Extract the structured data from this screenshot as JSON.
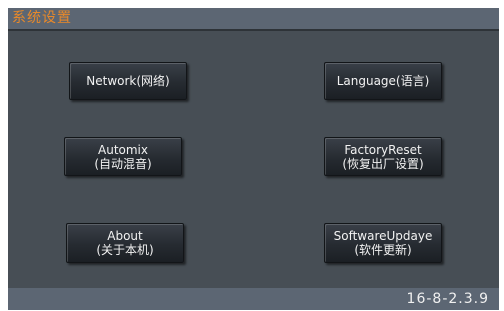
{
  "window": {
    "title": "系统设置"
  },
  "buttons": {
    "network": {
      "line1": "Network(网络)"
    },
    "language": {
      "line1": "Language(语言)"
    },
    "automix": {
      "line1": "Automix",
      "line2": "(自动混音)"
    },
    "factory_reset": {
      "line1": "FactoryReset",
      "line2": "(恢复出厂设置)"
    },
    "about": {
      "line1": "About",
      "line2": "(关于本机)"
    },
    "software_update": {
      "line1": "SoftwareUpdaye",
      "line2": "(软件更新)"
    }
  },
  "status": {
    "version": "16-8-2.3.9"
  },
  "colors": {
    "title_text": "#e8892a",
    "panel_background": "#474e55",
    "bar_background": "#5c6673",
    "button_text": "#f2f2f2"
  }
}
